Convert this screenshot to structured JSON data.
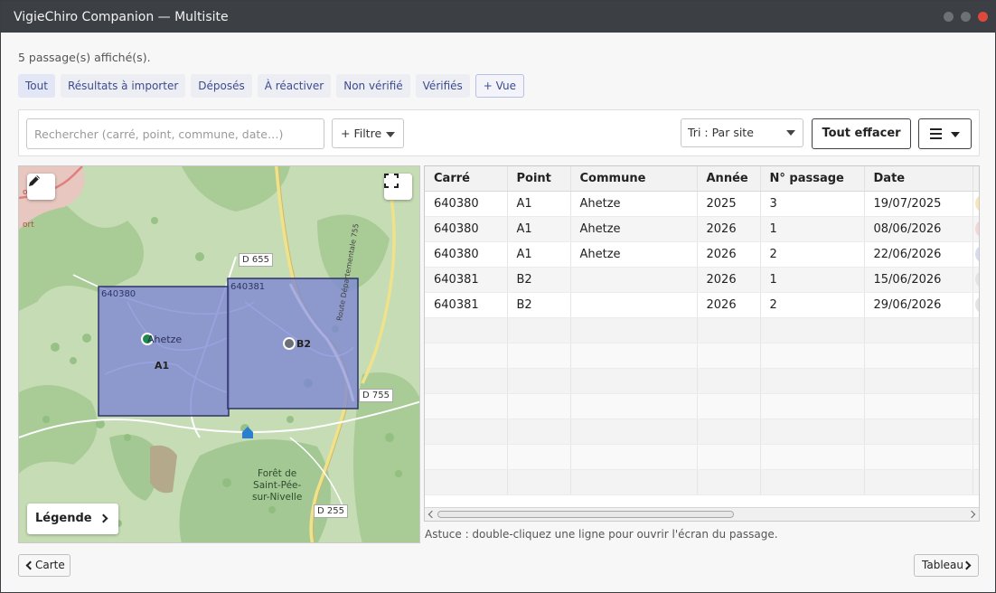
{
  "window": {
    "title": "VigieChiro Companion — Multisite"
  },
  "status": {
    "count_text": "5 passage(s) affiché(s)."
  },
  "view_tabs": [
    {
      "label": "Tout",
      "active": true
    },
    {
      "label": "Résultats à importer",
      "active": false
    },
    {
      "label": "Déposés",
      "active": false
    },
    {
      "label": "À réactiver",
      "active": false
    },
    {
      "label": "Non vérifié",
      "active": false
    },
    {
      "label": "Vérifiés",
      "active": false
    }
  ],
  "add_view_label": "+ Vue",
  "toolbar": {
    "search_placeholder": "Rechercher (carré, point, commune, date…)",
    "filter_label": "+ Filtre",
    "sort_label": "Tri : Par site",
    "clear_label": "Tout effacer"
  },
  "map": {
    "legend_label": "Légende",
    "squares": [
      {
        "label": "640380"
      },
      {
        "label": "640381"
      }
    ],
    "points": [
      {
        "label": "A1",
        "color": "#1e8a4c"
      },
      {
        "label": "B2",
        "color": "#6b6f78"
      }
    ],
    "place_labels": {
      "ahetze": "Ahetze",
      "foret": [
        "Forêt de",
        "Saint-Pée-",
        "sur-Nivelle"
      ],
      "route_dept": "Route Départementale 755",
      "ort": "ort",
      "d655": "D 655",
      "d755": "D 755",
      "d255": "D 255"
    }
  },
  "table": {
    "columns": [
      "Carré",
      "Point",
      "Commune",
      "Année",
      "N° passage",
      "Date",
      ""
    ],
    "rows": [
      [
        "640380",
        "A1",
        "Ahetze",
        "2025",
        "3",
        "19/07/2025",
        ""
      ],
      [
        "640380",
        "A1",
        "Ahetze",
        "2026",
        "1",
        "08/06/2026",
        ""
      ],
      [
        "640380",
        "A1",
        "Ahetze",
        "2026",
        "2",
        "22/06/2026",
        ""
      ],
      [
        "640381",
        "B2",
        "",
        "2026",
        "1",
        "15/06/2026",
        ""
      ],
      [
        "640381",
        "B2",
        "",
        "2026",
        "2",
        "29/06/2026",
        ""
      ]
    ],
    "row_status_colors": [
      "#f7e6b8",
      "#f4d6d6",
      "#d9dcef",
      "#e4e4e4",
      "#e4e4e4"
    ]
  },
  "hint": "Astuce : double-cliquez une ligne pour ouvrir l'écran du passage.",
  "nav": {
    "left_label": "Carte",
    "right_label": "Tableau"
  },
  "colors": {
    "accent": "#3d4b8f",
    "titlebar": "#3c3f44",
    "square_fill": "#7c86d4"
  }
}
